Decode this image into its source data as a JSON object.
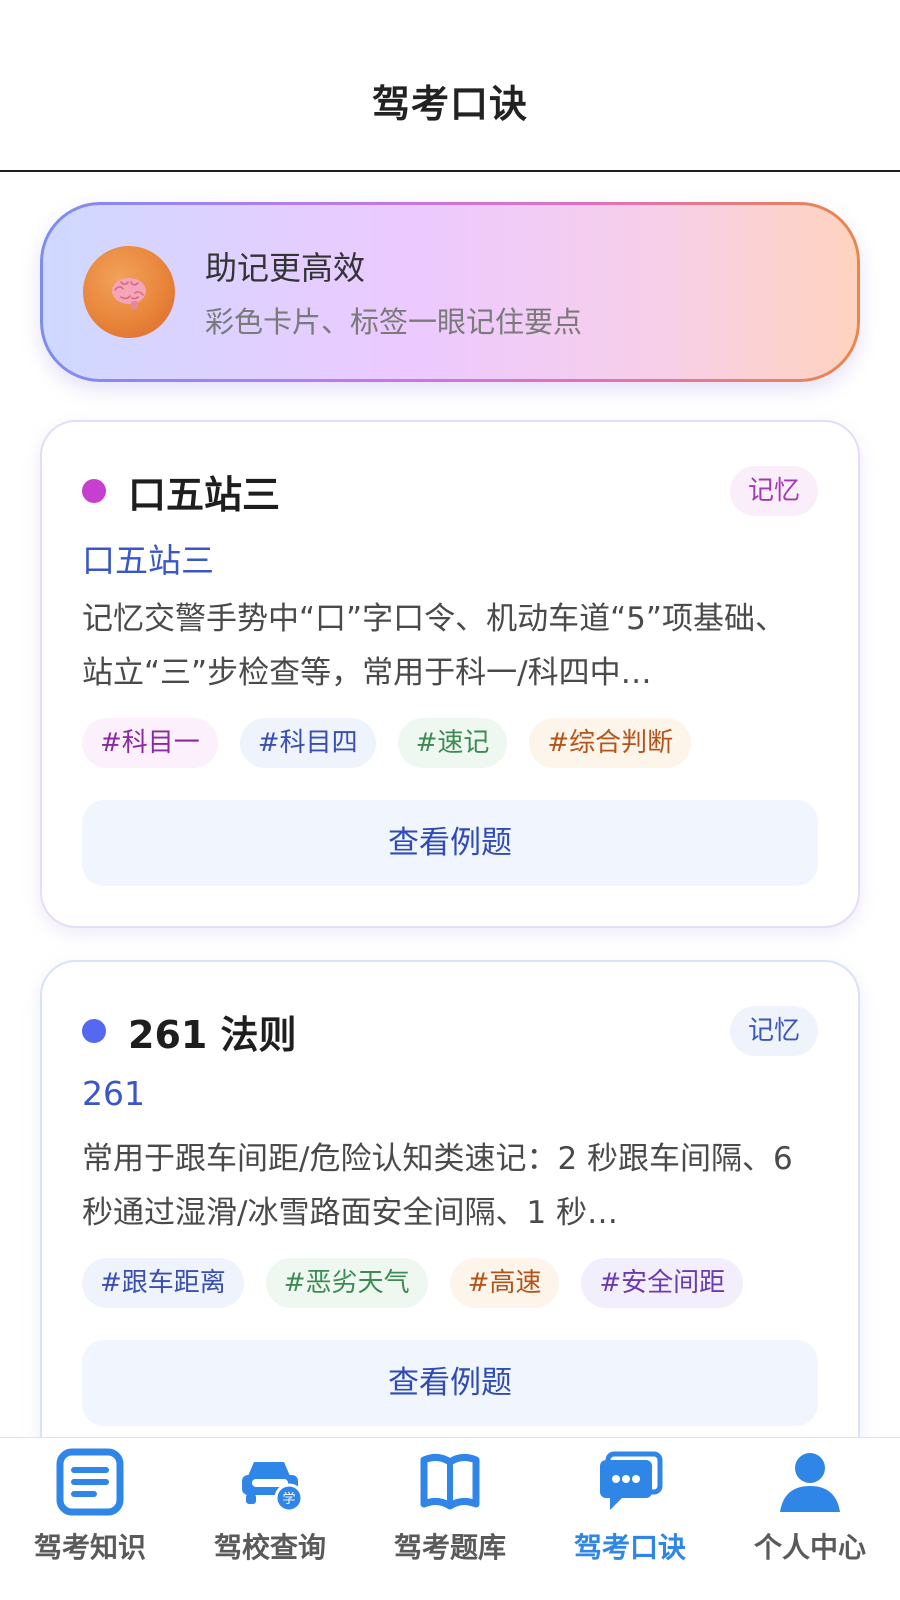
{
  "header": {
    "title": "驾考口诀"
  },
  "banner": {
    "title": "助记更高效",
    "subtitle": "彩色卡片、标签一眼记住要点",
    "icon": "brain-icon"
  },
  "cards": [
    {
      "title": "口五站三",
      "dot_color": "#c73fd0",
      "memo_tag": "记忆",
      "subtitle": "口五站三",
      "description": "记忆交警手势中“口”字口令、机动车道“5”项基础、站立“三”步检查等，常用于科一/科四中…",
      "tags": [
        "#科目一",
        "#科目四",
        "#速记",
        "#综合判断"
      ],
      "button": "查看例题"
    },
    {
      "title": "261 法则",
      "dot_color": "#5468f0",
      "memo_tag": "记忆",
      "subtitle": "261",
      "description": "常用于跟车间距/危险认知类速记：2 秒跟车间隔、6 秒通过湿滑/冰雪路面安全间隔、1 秒…",
      "tags": [
        "#跟车距离",
        "#恶劣天气",
        "#高速",
        "#安全间距"
      ],
      "button": "查看例题"
    }
  ],
  "nav": [
    {
      "label": "驾考知识",
      "icon": "document-icon",
      "active": false
    },
    {
      "label": "驾校查询",
      "icon": "car-icon",
      "active": false
    },
    {
      "label": "驾考题库",
      "icon": "book-icon",
      "active": false
    },
    {
      "label": "驾考口诀",
      "icon": "chat-icon",
      "active": true
    },
    {
      "label": "个人中心",
      "icon": "user-icon",
      "active": false
    }
  ]
}
